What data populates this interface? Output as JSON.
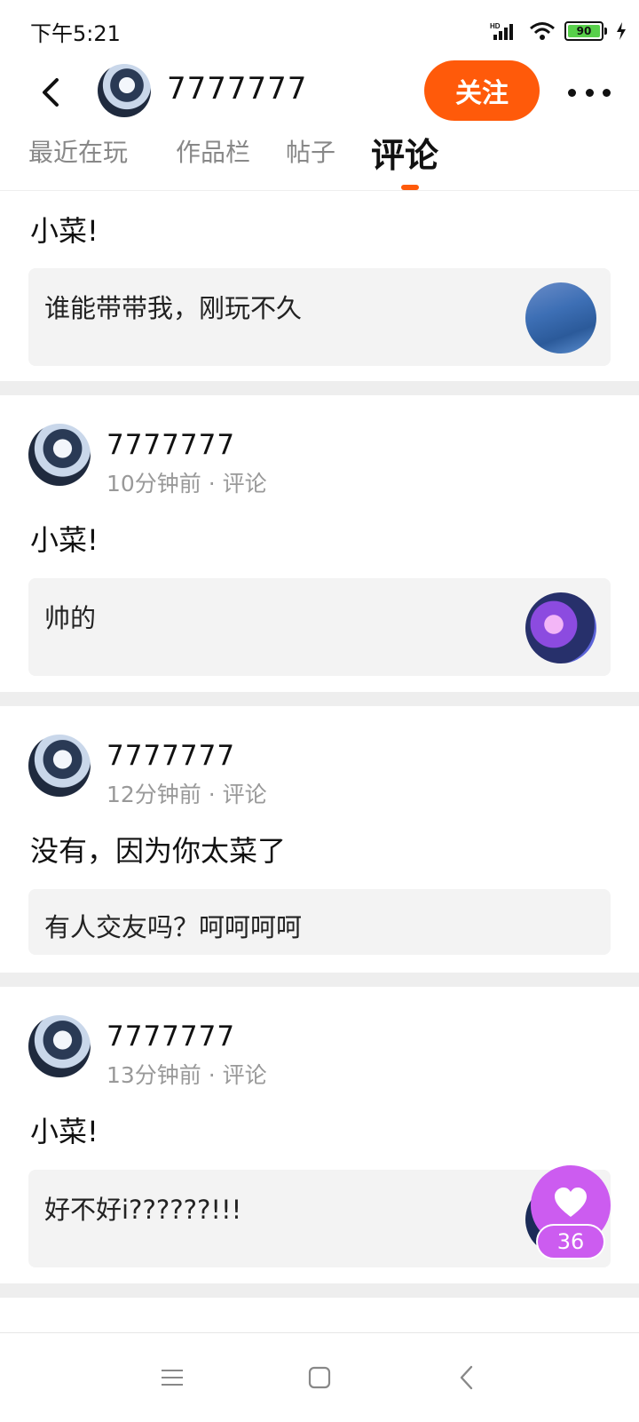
{
  "status_bar": {
    "time": "下午5:21",
    "battery": "90",
    "network": "HD"
  },
  "header": {
    "title": "7777777",
    "follow_label": "关注"
  },
  "tabs": [
    {
      "label": "最近在玩"
    },
    {
      "label": "作品栏"
    },
    {
      "label": "帖子"
    },
    {
      "label": "评论",
      "active": true
    }
  ],
  "posts": [
    {
      "text": "小菜!",
      "quote": "谁能带带我，刚玩不久"
    },
    {
      "user": "7777777",
      "time": "10分钟前",
      "type": "评论",
      "text": "小菜!",
      "quote": "帅的"
    },
    {
      "user": "7777777",
      "time": "12分钟前",
      "type": "评论",
      "text": "没有，因为你太菜了",
      "quote": "有人交友吗？呵呵呵呵"
    },
    {
      "user": "7777777",
      "time": "13分钟前",
      "type": "评论",
      "text": "小菜!",
      "quote": "好不好i??????!!!"
    }
  ],
  "like_button": {
    "count": "36"
  },
  "colors": {
    "accent": "#ff5a0a",
    "like": "#cc5cf0",
    "separator": "#eeeeee"
  },
  "icons": [
    "back-icon",
    "more-icon",
    "signal-icon",
    "wifi-icon",
    "battery-icon",
    "charging-icon",
    "heart-icon",
    "menu-icon",
    "home-icon",
    "nav-back-icon"
  ]
}
